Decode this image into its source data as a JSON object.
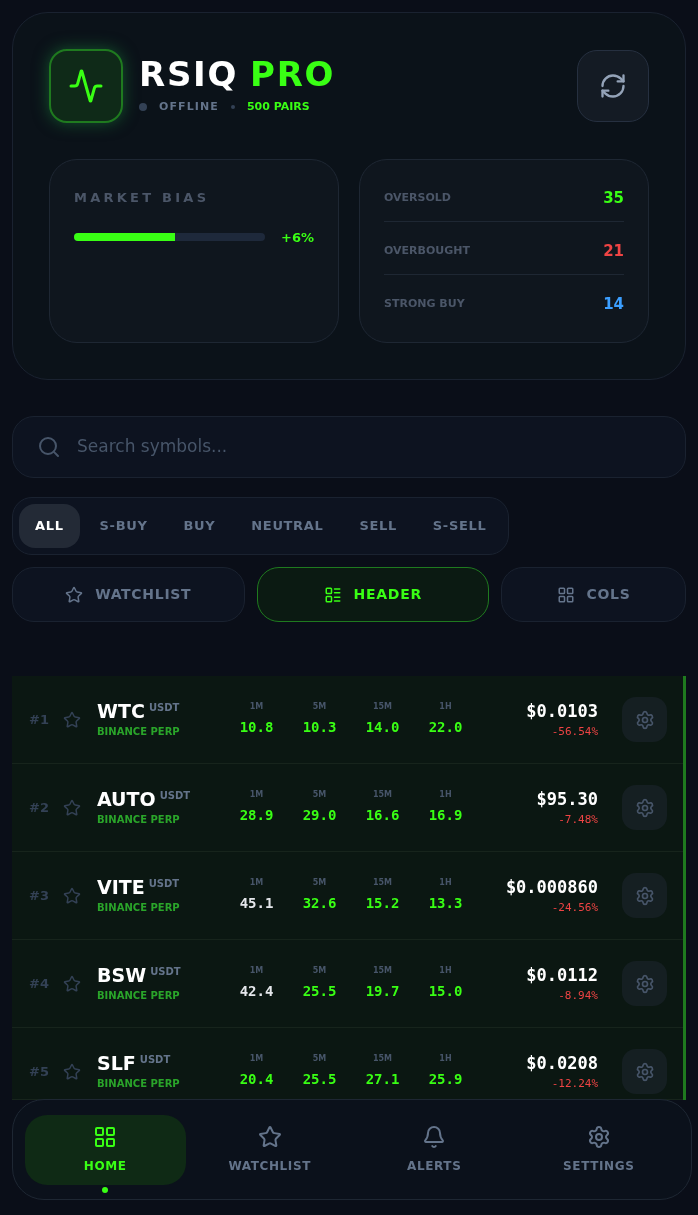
{
  "app": {
    "title_main": "RSIQ",
    "title_accent": "PRO",
    "status": "OFFLINE",
    "online": false,
    "pairs": "500 PAIRS"
  },
  "market_bias": {
    "label": "MARKET BIAS",
    "level": 0.53,
    "reading": "+6%"
  },
  "stats": [
    {
      "label": "OVERSOLD",
      "value": "35",
      "color": "#39ff14"
    },
    {
      "label": "OVERBOUGHT",
      "value": "21",
      "color": "#ef4444"
    },
    {
      "label": "STRONG BUY",
      "value": "14",
      "color": "#3b9eff"
    }
  ],
  "search": {
    "placeholder": "Search symbols..."
  },
  "filters": [
    {
      "label": "ALL",
      "selected": true
    },
    {
      "label": "S-BUY",
      "selected": false
    },
    {
      "label": "BUY",
      "selected": false
    },
    {
      "label": "NEUTRAL",
      "selected": false
    },
    {
      "label": "SELL",
      "selected": false
    },
    {
      "label": "S-SELL",
      "selected": false
    }
  ],
  "toggles": [
    {
      "label": "WATCHLIST",
      "kind": "star",
      "on": false
    },
    {
      "label": "HEADER",
      "kind": "list",
      "on": true
    },
    {
      "label": "COLS",
      "kind": "grid",
      "on": false
    }
  ],
  "rows": [
    {
      "rank": "#1",
      "symbol": "WTC",
      "quote": "USDT",
      "exchange": "BINANCE PERP",
      "rsi": [
        {
          "tf": "1M",
          "value": "10.8",
          "kind": "oversold"
        },
        {
          "tf": "5M",
          "value": "10.3",
          "kind": "oversold"
        },
        {
          "tf": "15M",
          "value": "14.0",
          "kind": "oversold"
        },
        {
          "tf": "1H",
          "value": "22.0",
          "kind": "oversold"
        }
      ],
      "price": "$0.0103",
      "change": "-56.54%"
    },
    {
      "rank": "#2",
      "symbol": "AUTO",
      "quote": "USDT",
      "exchange": "BINANCE PERP",
      "rsi": [
        {
          "tf": "1M",
          "value": "28.9",
          "kind": "oversold"
        },
        {
          "tf": "5M",
          "value": "29.0",
          "kind": "oversold"
        },
        {
          "tf": "15M",
          "value": "16.6",
          "kind": "oversold"
        },
        {
          "tf": "1H",
          "value": "16.9",
          "kind": "oversold"
        }
      ],
      "price": "$95.30",
      "change": "-7.48%"
    },
    {
      "rank": "#3",
      "symbol": "VITE",
      "quote": "USDT",
      "exchange": "BINANCE PERP",
      "rsi": [
        {
          "tf": "1M",
          "value": "45.1",
          "kind": "neutral"
        },
        {
          "tf": "5M",
          "value": "32.6",
          "kind": "oversold"
        },
        {
          "tf": "15M",
          "value": "15.2",
          "kind": "oversold"
        },
        {
          "tf": "1H",
          "value": "13.3",
          "kind": "oversold"
        }
      ],
      "price": "$0.000860",
      "change": "-24.56%"
    },
    {
      "rank": "#4",
      "symbol": "BSW",
      "quote": "USDT",
      "exchange": "BINANCE PERP",
      "rsi": [
        {
          "tf": "1M",
          "value": "42.4",
          "kind": "neutral"
        },
        {
          "tf": "5M",
          "value": "25.5",
          "kind": "oversold"
        },
        {
          "tf": "15M",
          "value": "19.7",
          "kind": "oversold"
        },
        {
          "tf": "1H",
          "value": "15.0",
          "kind": "oversold"
        }
      ],
      "price": "$0.0112",
      "change": "-8.94%"
    },
    {
      "rank": "#5",
      "symbol": "SLF",
      "quote": "USDT",
      "exchange": "BINANCE PERP",
      "rsi": [
        {
          "tf": "1M",
          "value": "20.4",
          "kind": "oversold"
        },
        {
          "tf": "5M",
          "value": "25.5",
          "kind": "oversold"
        },
        {
          "tf": "15M",
          "value": "27.1",
          "kind": "oversold"
        },
        {
          "tf": "1H",
          "value": "25.9",
          "kind": "oversold"
        }
      ],
      "price": "$0.0208",
      "change": "-12.24%"
    }
  ],
  "nav": [
    {
      "label": "HOME",
      "kind": "home",
      "selected": true
    },
    {
      "label": "WATCHLIST",
      "kind": "star",
      "selected": false
    },
    {
      "label": "ALERTS",
      "kind": "bell",
      "selected": false
    },
    {
      "label": "SETTINGS",
      "kind": "gear",
      "selected": false
    }
  ]
}
